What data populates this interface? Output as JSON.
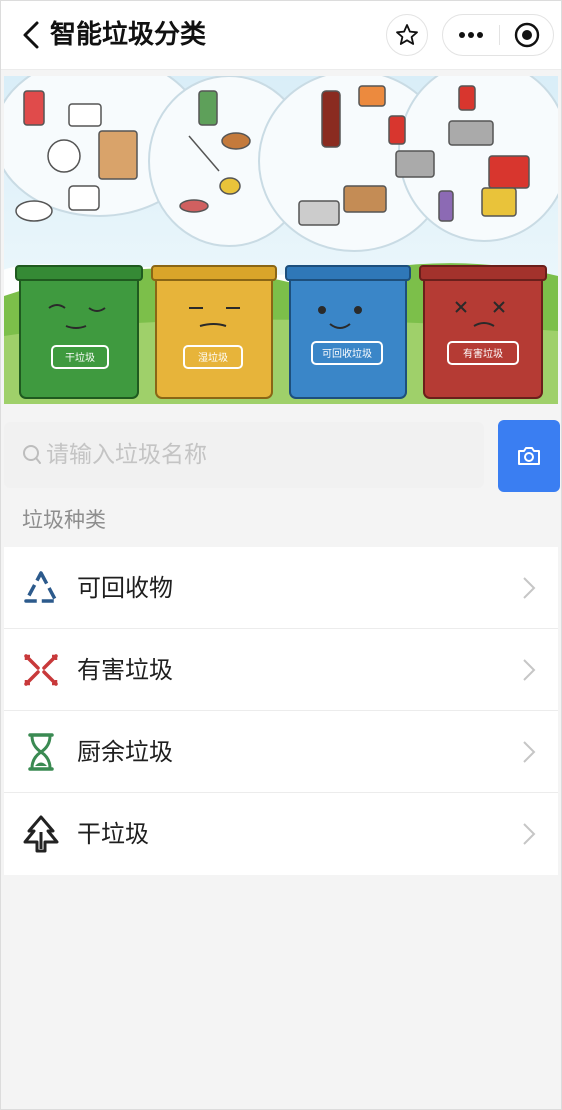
{
  "nav": {
    "title": "智能垃圾分类"
  },
  "icons": {
    "back": "chevron-left-icon",
    "favorite": "star-icon",
    "more": "more-dots-icon",
    "close": "record-close-icon",
    "search": "search-icon",
    "camera": "camera-icon"
  },
  "banner": {
    "bins": [
      {
        "label": "干垃圾",
        "color": "#3f9a3f"
      },
      {
        "label": "湿垃圾",
        "color": "#e7b43a"
      },
      {
        "label": "可回收垃圾",
        "color": "#3a86c8"
      },
      {
        "label": "有害垃圾",
        "color": "#b53b34"
      }
    ]
  },
  "search": {
    "placeholder": "请输入垃圾名称",
    "value": ""
  },
  "section": {
    "title": "垃圾种类"
  },
  "categories": [
    {
      "label": "可回收物",
      "icon": "recycle-triangle-icon",
      "color": "#2c5a8c"
    },
    {
      "label": "有害垃圾",
      "icon": "hazard-cross-icon",
      "color": "#c8393a"
    },
    {
      "label": "厨余垃圾",
      "icon": "hourglass-icon",
      "color": "#3a8a52"
    },
    {
      "label": "干垃圾",
      "icon": "tree-outline-icon",
      "color": "#222222"
    }
  ],
  "colors": {
    "accent": "#3a7ef2",
    "background": "#f4f4f4"
  }
}
